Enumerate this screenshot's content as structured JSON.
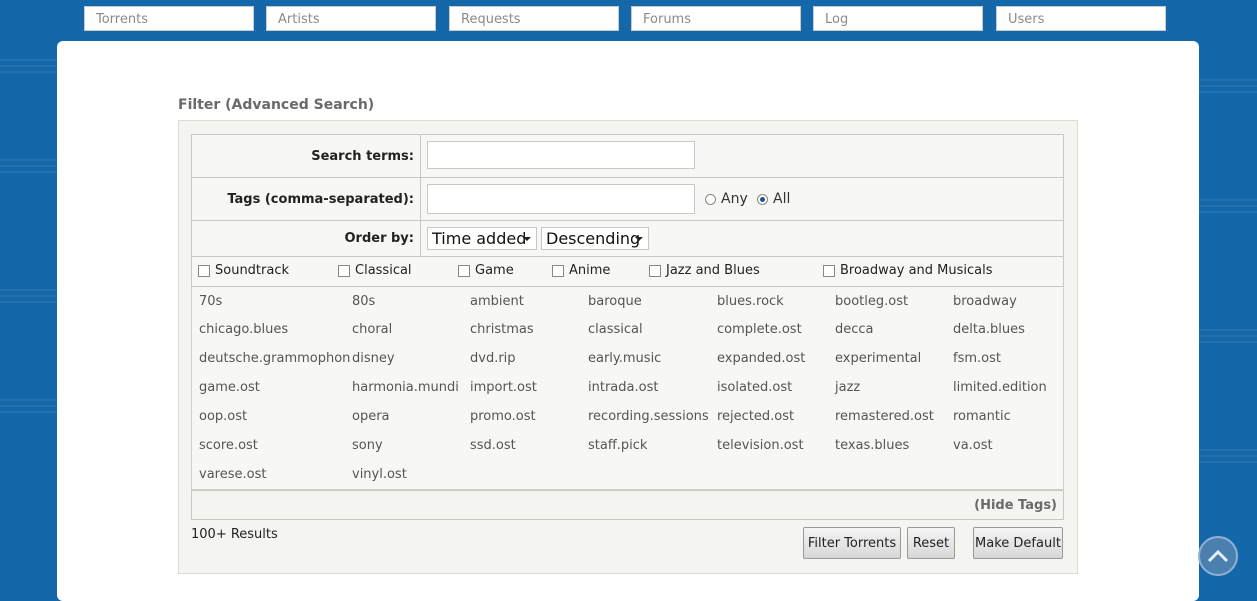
{
  "nav": [
    "Torrents",
    "Artists",
    "Requests",
    "Forums",
    "Log",
    "Users"
  ],
  "filter": {
    "heading": "Filter (Advanced Search)",
    "search_terms_label": "Search terms:",
    "search_terms_value": "",
    "tags_label": "Tags (comma-separated):",
    "tags_value": "",
    "tag_mode_any": "Any",
    "tag_mode_all": "All",
    "tag_mode_selected": "All",
    "order_label": "Order by:",
    "order_by": "Time added",
    "order_dir": "Descending"
  },
  "categories": [
    "Soundtrack",
    "Classical",
    "Game",
    "Anime",
    "Jazz and Blues",
    "Broadway and Musicals"
  ],
  "tags": [
    [
      "70s",
      "80s",
      "ambient",
      "baroque",
      "blues.rock",
      "bootleg.ost",
      "broadway"
    ],
    [
      "chicago.blues",
      "choral",
      "christmas",
      "classical",
      "complete.ost",
      "decca",
      "delta.blues"
    ],
    [
      "deutsche.grammophon",
      "disney",
      "dvd.rip",
      "early.music",
      "expanded.ost",
      "experimental",
      "fsm.ost"
    ],
    [
      "game.ost",
      "harmonia.mundi",
      "import.ost",
      "intrada.ost",
      "isolated.ost",
      "jazz",
      "limited.edition"
    ],
    [
      "oop.ost",
      "opera",
      "promo.ost",
      "recording.sessions",
      "rejected.ost",
      "remastered.ost",
      "romantic"
    ],
    [
      "score.ost",
      "sony",
      "ssd.ost",
      "staff.pick",
      "television.ost",
      "texas.blues",
      "va.ost"
    ],
    [
      "varese.ost",
      "vinyl.ost"
    ]
  ],
  "hide_tags": "(Hide Tags)",
  "results": "100+ Results",
  "buttons": {
    "filter": "Filter Torrents",
    "reset": "Reset",
    "make_default": "Make Default"
  },
  "icons": {
    "scroll_top": "chevron-up-icon",
    "dropdown": "caret-down-icon"
  },
  "colors": {
    "background": "#1467a8",
    "panel": "#ffffff"
  }
}
